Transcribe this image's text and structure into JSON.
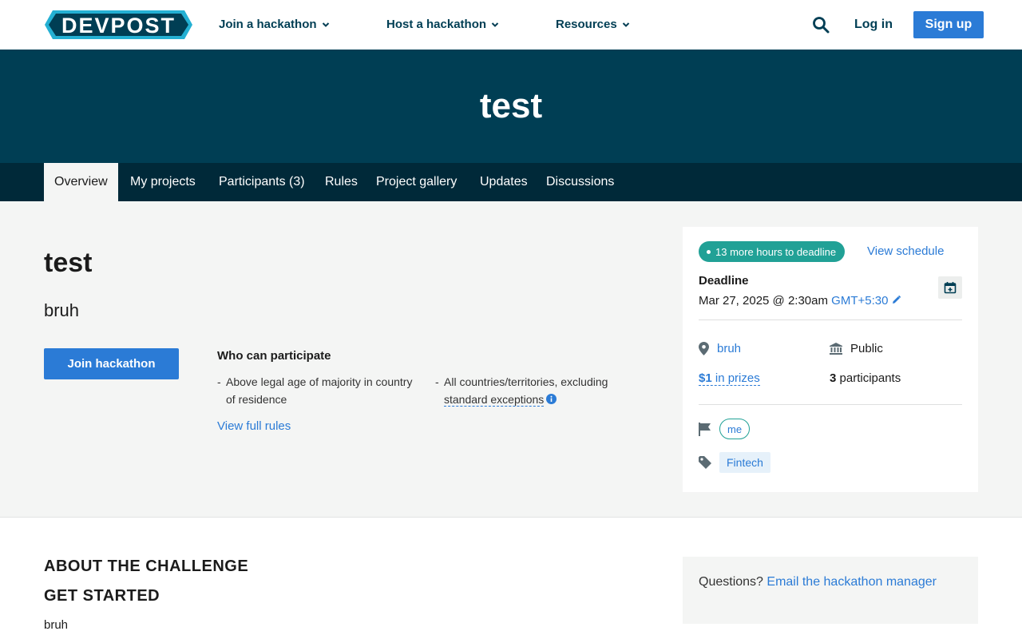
{
  "brand": {
    "logo_text": "DEVPOST"
  },
  "nav": {
    "items": [
      "Join a hackathon",
      "Host a hackathon",
      "Resources"
    ],
    "login": "Log in",
    "signup": "Sign up"
  },
  "hero": {
    "title": "test"
  },
  "tabs": [
    "Overview",
    "My projects",
    "Participants (3)",
    "Rules",
    "Project gallery",
    "Updates",
    "Discussions"
  ],
  "overview": {
    "title": "test",
    "tagline": "bruh",
    "join_label": "Join hackathon",
    "who_title": "Who can participate",
    "elig_1": "Above legal age of majority in country of residence",
    "elig_2_prefix": "All countries/territories, excluding",
    "elig_2_link": "standard exceptions",
    "rules_link": "View full rules"
  },
  "sidebar": {
    "deadline_pill": "13 more hours to deadline",
    "schedule_link": "View schedule",
    "deadline_label": "Deadline",
    "deadline_date": "Mar 27, 2025 @ 2:30am",
    "timezone": "GMT+5:30",
    "location": "bruh",
    "visibility": "Public",
    "prize_amount": "$1",
    "prize_suffix": " in prizes",
    "participant_count": "3",
    "participant_suffix": " participants",
    "host_tag": "me",
    "theme_tag": "Fintech"
  },
  "about": {
    "heading": "ABOUT THE CHALLENGE",
    "subheading": "GET STARTED",
    "body": "bruh",
    "questions_prefix": "Questions?",
    "questions_link": "Email the hackathon manager"
  },
  "colors": {
    "primary_dark": "#003e54",
    "tab_bar": "#002939",
    "accent_blue": "#2b7bd6",
    "teal": "#21a196",
    "logo_cyan": "#24b0d3"
  }
}
